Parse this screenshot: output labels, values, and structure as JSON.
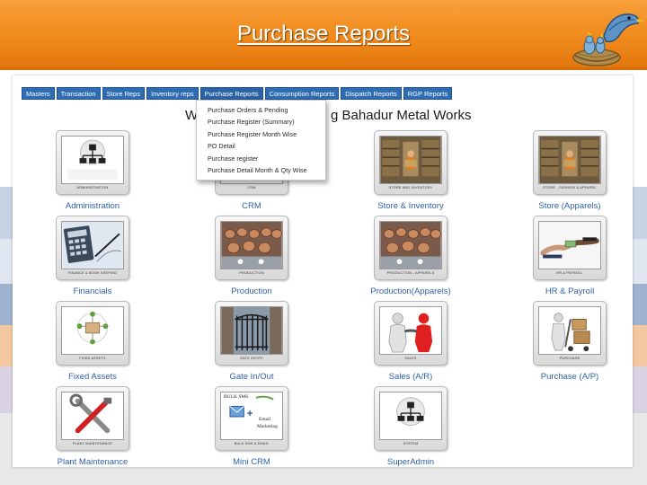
{
  "slide": {
    "title": "Purchase Reports"
  },
  "menu": [
    "Masters",
    "Transaction",
    "Store Reps",
    "Inventory reps",
    "Purchase Reports",
    "Consumption Reports",
    "Dispatch Reports",
    "RGP Reports"
  ],
  "welcome": {
    "prefix": "W",
    "suffix": "g Bahadur Metal Works"
  },
  "dropdown": [
    "Purchase Orders & Pending",
    "Purchase Register (Summary)",
    "Purchase Register Month Wise",
    "PO Detail",
    "Purchase register",
    "Purchase Detail Month & Qty Wise"
  ],
  "modules": [
    {
      "label": "Administration",
      "caption": "ADMINISTRATION",
      "icon": "org-chart-icon"
    },
    {
      "label": "CRM",
      "caption": "CRM",
      "icon": "crm-icon"
    },
    {
      "label": "Store & Inventory",
      "caption": "STORE AND INVENTORY",
      "icon": "warehouse-icon"
    },
    {
      "label": "Store (Apparels)",
      "caption": "STORE - FASHION & APPAREL",
      "icon": "warehouse-apparel-icon"
    },
    {
      "label": "Financials",
      "caption": "FINANCE & BOOK KEEPING",
      "icon": "calculator-icon"
    },
    {
      "label": "Production",
      "caption": "PRODUCTION",
      "icon": "factory-icon"
    },
    {
      "label": "Production(Apparels)",
      "caption": "PRODUCTION - APPARELS",
      "icon": "factory-apparel-icon"
    },
    {
      "label": "HR & Payroll",
      "caption": "HR & PAYROLL",
      "icon": "payroll-icon"
    },
    {
      "label": "Fixed Assets",
      "caption": "FIXED ASSETS",
      "icon": "assets-icon"
    },
    {
      "label": "Gate In/Out",
      "caption": "GATE ENTRY",
      "icon": "gate-icon"
    },
    {
      "label": "Sales (A/R)",
      "caption": "SALES",
      "icon": "handshake-icon"
    },
    {
      "label": "Purchase (A/P)",
      "caption": "PURCHASE",
      "icon": "hand-truck-icon"
    },
    {
      "label": "Plant Maintenance",
      "caption": "PLANT MAINTENANCE",
      "icon": "tools-icon"
    },
    {
      "label": "Mini CRM",
      "caption": "BULK SMS & EMAIL",
      "icon": "email-marketing-icon"
    },
    {
      "label": "SuperAdmin",
      "caption": "SYSTEM",
      "icon": "system-icon"
    }
  ],
  "email_tile": {
    "sms_text": "BULK SMS",
    "email_text": "Email",
    "marketing_text": "Marketing"
  },
  "colors": {
    "header": "#f08a1c",
    "menu": "#2f6db3",
    "module_label": "#2e63a8"
  }
}
